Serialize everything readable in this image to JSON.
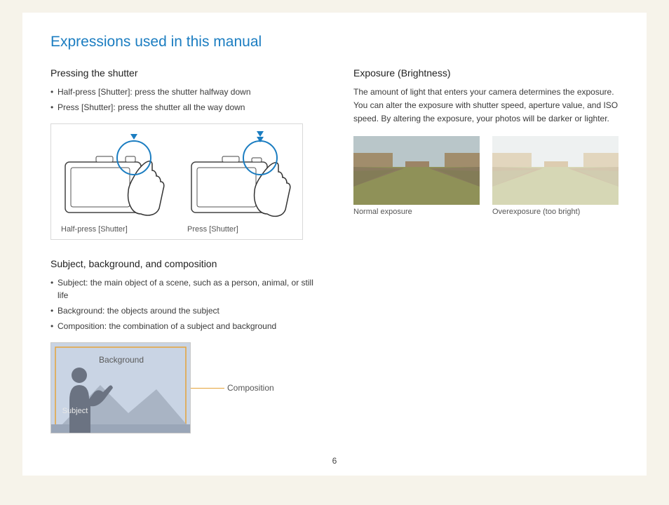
{
  "title": "Expressions used in this manual",
  "pageNumber": "6",
  "left": {
    "subhead1": "Pressing the shutter",
    "bullet1_prefix": "Half-press [",
    "bullet1_bold": "Shutter",
    "bullet1_suffix": "]: press the shutter halfway down",
    "bullet2_prefix": "Press [",
    "bullet2_bold": "Shutter",
    "bullet2_suffix": "]: press the shutter all the way down",
    "caption1_prefix": "Half-press [",
    "caption1_bold": "Shutter",
    "caption1_suffix": "]",
    "caption2_prefix": "Press [",
    "caption2_bold": "Shutter",
    "caption2_suffix": "]",
    "subhead2": "Subject, background, and composition",
    "b3_bold": "Subject",
    "b3_rest": ": the main object of a scene, such as a person, animal, or still life",
    "b4_bold": "Background",
    "b4_rest": ": the objects around the subject",
    "b5_bold": "Composition",
    "b5_rest": ": the combination of a subject and background",
    "comp_background": "Background",
    "comp_subject": "Subject",
    "comp_composition": "Composition"
  },
  "right": {
    "subhead": "Exposure (Brightness)",
    "paragraph": "The amount of light that enters your camera determines the exposure. You can alter the exposure with shutter speed, aperture value, and ISO speed. By altering the exposure, your photos will be darker or lighter.",
    "caption_normal": "Normal exposure",
    "caption_over": "Overexposure (too bright)"
  }
}
